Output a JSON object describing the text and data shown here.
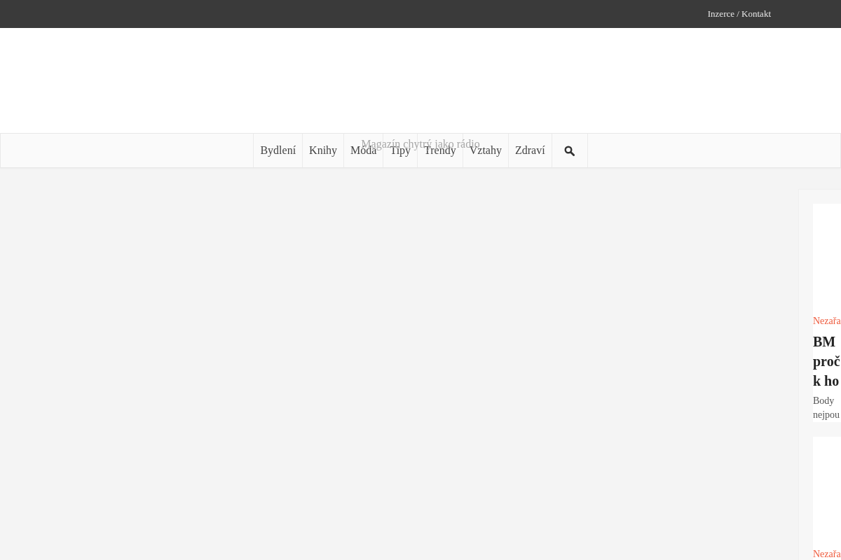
{
  "top_bar": {
    "link": "Inzerce / Kontakt"
  },
  "header": {
    "tagline": "Magazín chytrý jako rádio"
  },
  "nav": {
    "items": [
      "Bydlení",
      "Knihy",
      "Móda",
      "Tipy",
      "Trendy",
      "Vztahy",
      "Zdraví"
    ]
  },
  "sidebar": {
    "cards": [
      {
        "category": "Nezařa",
        "title": "BM\nproč\nk ho",
        "excerpt": "Body\nnejpou"
      },
      {
        "category": "Nezařa"
      }
    ]
  }
}
